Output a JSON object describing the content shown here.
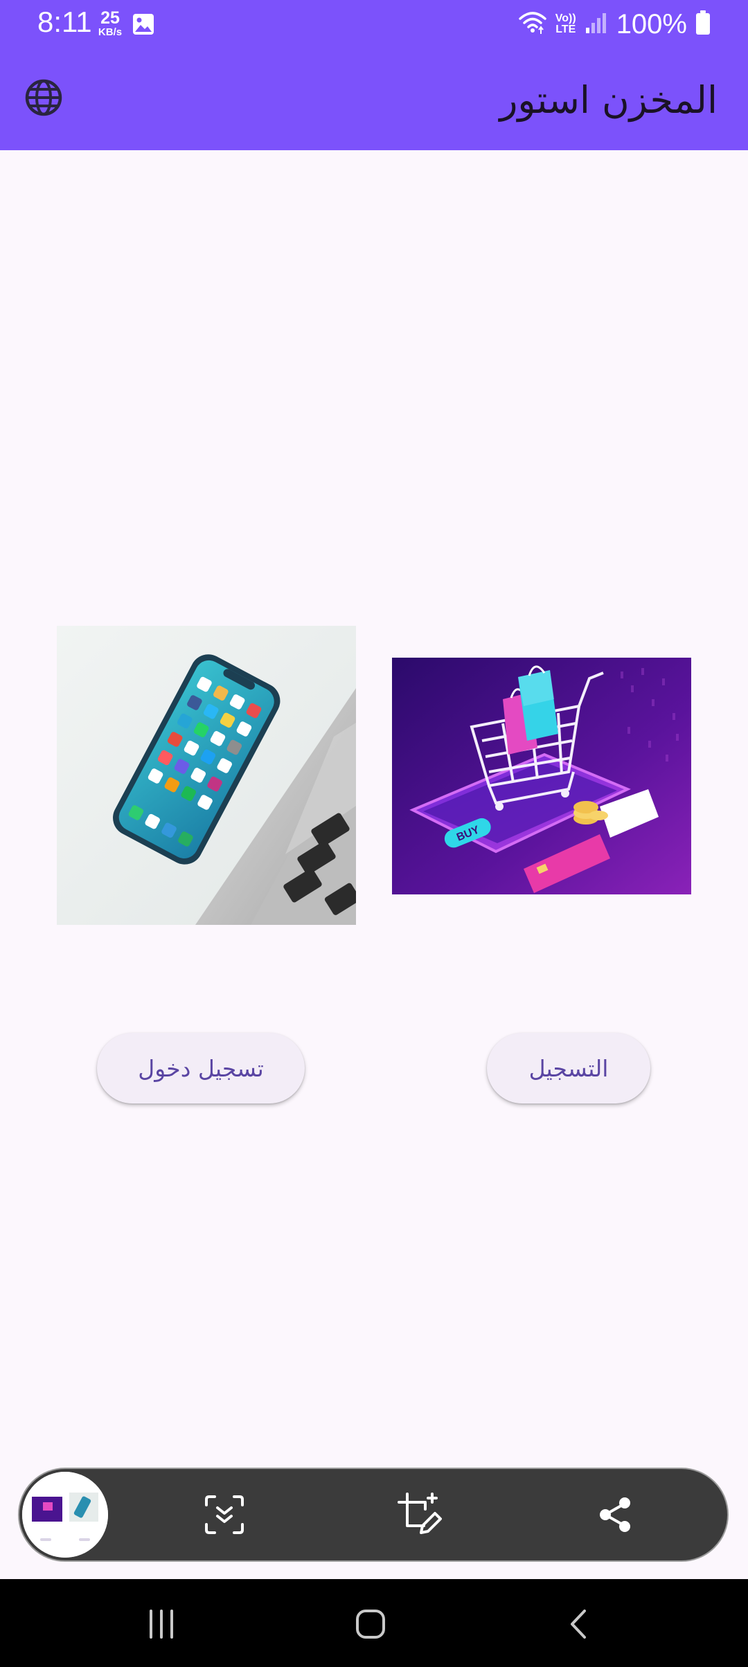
{
  "status_bar": {
    "time": "8:11",
    "net_speed_value": "25",
    "net_speed_unit": "KB/s",
    "volte_label_top": "Vo))",
    "volte_label_bottom": "LTE",
    "battery_percent": "100%",
    "icons": [
      "gallery-icon",
      "wifi-icon",
      "volte-icon",
      "signal-icon",
      "battery-icon"
    ]
  },
  "app_bar": {
    "title": "المخزن استور",
    "background_color": "#7c52fb",
    "language_icon": "globe-icon"
  },
  "main": {
    "images": [
      {
        "name": "smartphone-photo",
        "alt": ""
      },
      {
        "name": "shopping-cart-illustration",
        "alt": "",
        "badge": "BUY"
      }
    ],
    "buttons": {
      "login_label": "تسجيل دخول",
      "register_label": "التسجيل"
    }
  },
  "screenshot_toolbar": {
    "icons": [
      "screenshot-thumbnail",
      "scroll-capture-icon",
      "crop-edit-icon",
      "share-icon"
    ]
  },
  "nav_bar": {
    "icons": [
      "recents-icon",
      "home-icon",
      "back-icon"
    ]
  }
}
